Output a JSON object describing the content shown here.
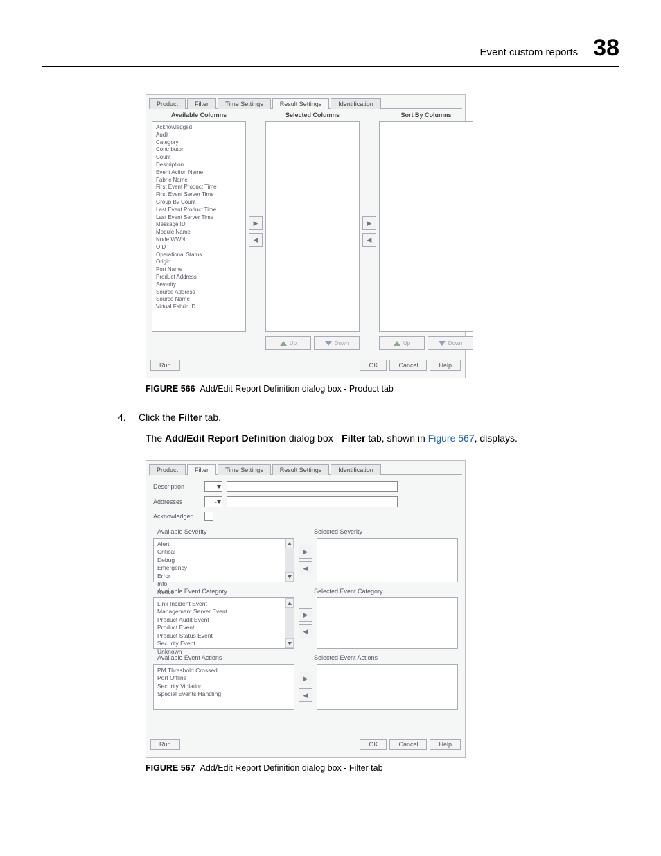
{
  "header": {
    "title": "Event custom reports",
    "chapter": "38"
  },
  "figure1": {
    "tabs": [
      "Product",
      "Filter",
      "Time Settings",
      "Result Settings",
      "Identification"
    ],
    "col_headers": {
      "available": "Available Columns",
      "selected": "Selected Columns",
      "sort": "Sort By Columns"
    },
    "available_columns": [
      "Acknowledged",
      "Audit",
      "Category",
      "Contributor",
      "Count",
      "Description",
      "Event Action Name",
      "Fabric Name",
      "First Event Product Time",
      "First Event Server Time",
      "Group By Count",
      "Last Event Product Time",
      "Last Event Server Time",
      "Message ID",
      "Module Name",
      "Node WWN",
      "OID",
      "Operational Status",
      "Origin",
      "Port Name",
      "Product Address",
      "Severity",
      "Source Address",
      "Source Name",
      "Virtual Fabric ID"
    ],
    "updown": {
      "up": "Up",
      "down": "Down"
    },
    "footer": {
      "run": "Run",
      "ok": "OK",
      "cancel": "Cancel",
      "help": "Help"
    },
    "caption_label": "FIGURE 566",
    "caption_text": "Add/Edit Report Definition dialog box - Product tab"
  },
  "step4": {
    "num": "4.",
    "text_pre": "Click the ",
    "text_bold": "Filter",
    "text_post": " tab."
  },
  "body": {
    "pre": "The ",
    "bold1": "Add/Edit Report Definition",
    "mid": " dialog box - ",
    "bold2": "Filter",
    "mid2": " tab, shown in ",
    "link": "Figure 567",
    "post": ", displays."
  },
  "figure2": {
    "tabs": [
      "Product",
      "Filter",
      "Time Settings",
      "Result Settings",
      "Identification"
    ],
    "form": {
      "description": "Description",
      "addresses": "Addresses",
      "ack": "Acknowledged"
    },
    "severity": {
      "avail_label": "Available Severity",
      "sel_label": "Selected Severity",
      "items": [
        "Alert",
        "Critical",
        "Debug",
        "Emergency",
        "Error",
        "Info",
        "Notice"
      ]
    },
    "category": {
      "avail_label": "Available Event Category",
      "sel_label": "Selected Event Category",
      "items": [
        "Link Incident Event",
        "Management Server Event",
        "Product Audit Event",
        "Product Event",
        "Product Status Event",
        "Security Event",
        "Unknown"
      ]
    },
    "actions": {
      "avail_label": "Available Event Actions",
      "sel_label": "Selected Event Actions",
      "items": [
        "PM Threshold Crossed",
        "Port Offline",
        "Security Violation",
        "Special Events Handling"
      ]
    },
    "footer": {
      "run": "Run",
      "ok": "OK",
      "cancel": "Cancel",
      "help": "Help"
    },
    "caption_label": "FIGURE 567",
    "caption_text": "Add/Edit Report Definition dialog box - Filter tab"
  }
}
